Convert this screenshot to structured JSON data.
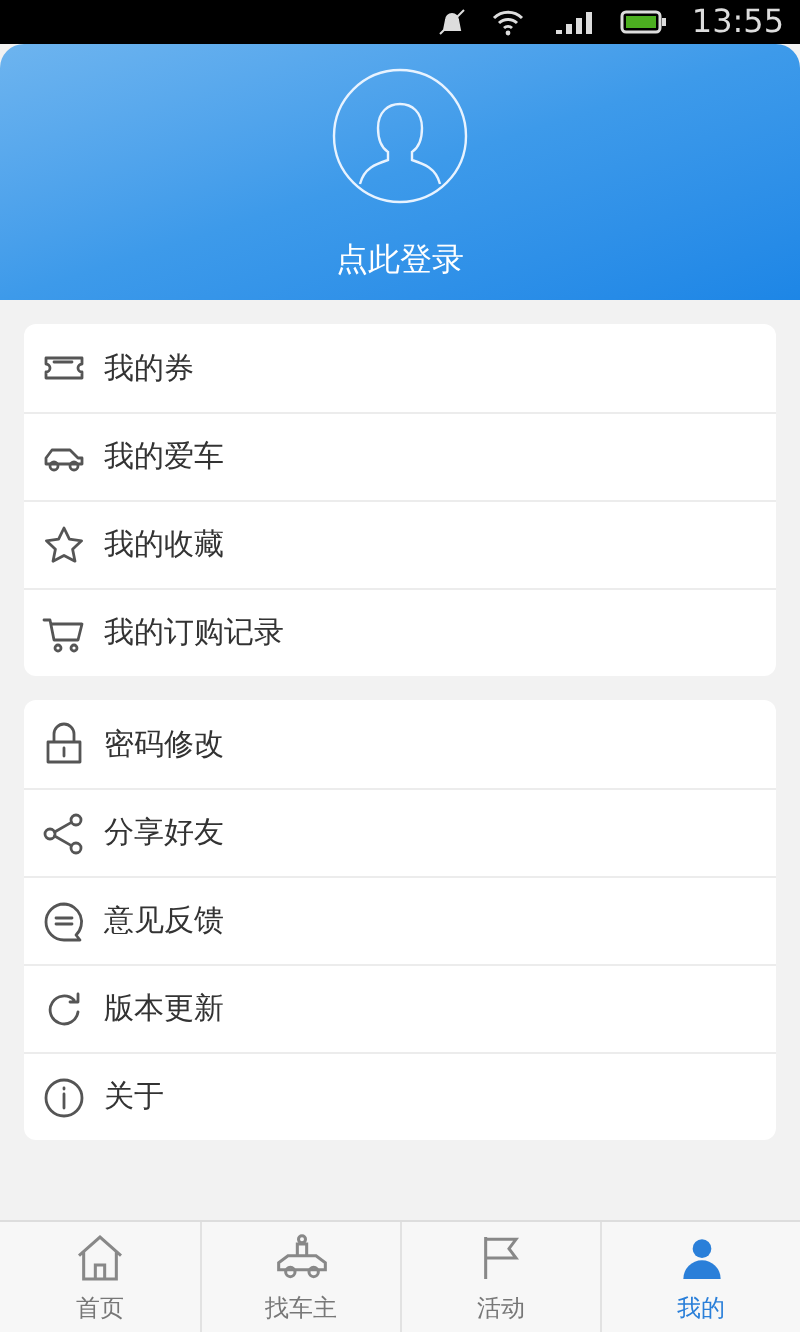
{
  "status_bar": {
    "time": "13:55"
  },
  "header": {
    "login_label": "点此登录"
  },
  "menu_groups": [
    {
      "items": [
        "我的券",
        "我的爱车",
        "我的收藏",
        "我的订购记录"
      ]
    },
    {
      "items": [
        "密码修改",
        "分享好友",
        "意见反馈",
        "版本更新",
        "关于"
      ]
    }
  ],
  "tab_bar": [
    {
      "label": "首页",
      "selected": false
    },
    {
      "label": "找车主",
      "selected": false
    },
    {
      "label": "活动",
      "selected": false
    },
    {
      "label": "我的",
      "selected": true
    }
  ]
}
